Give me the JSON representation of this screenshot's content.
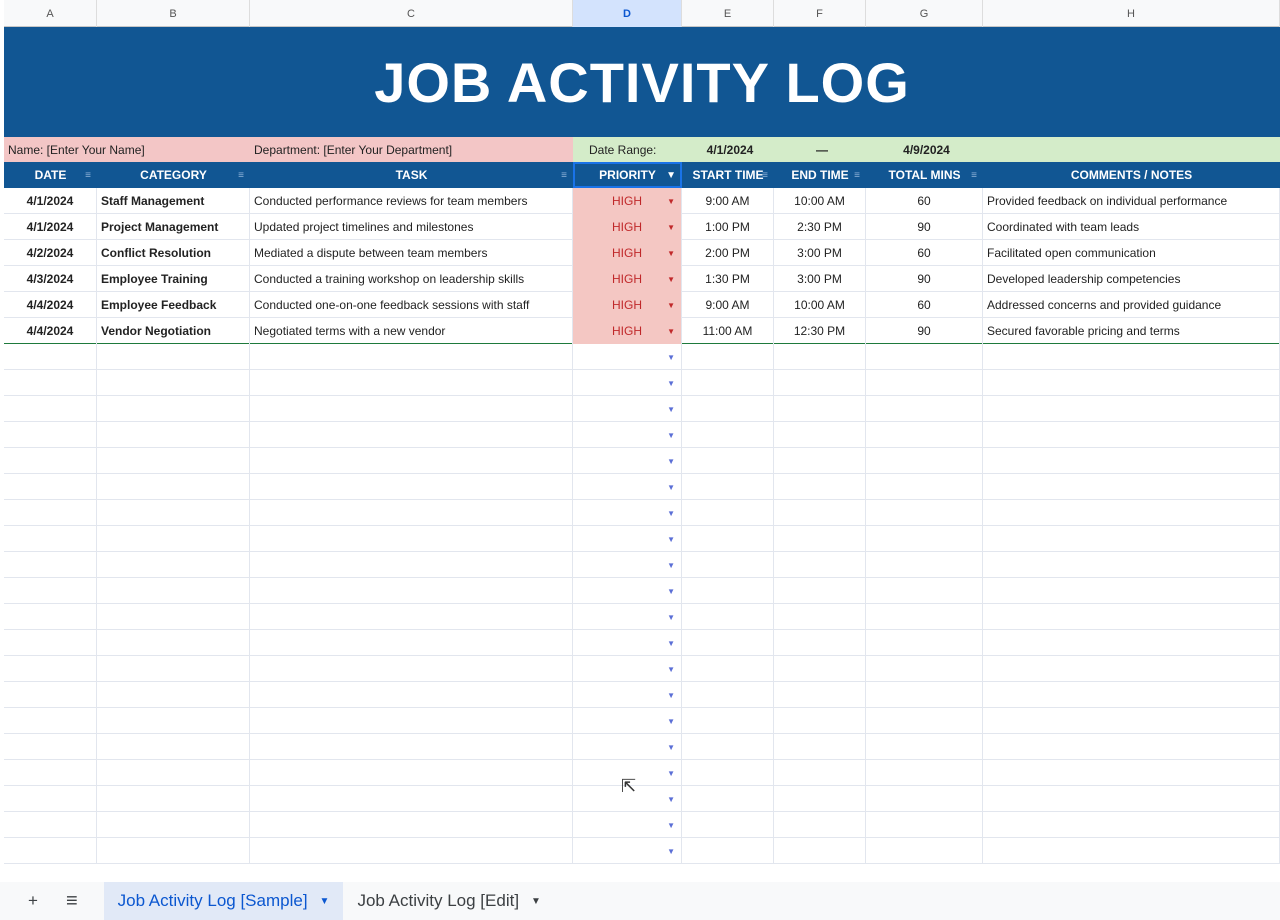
{
  "columns": [
    "A",
    "B",
    "C",
    "D",
    "E",
    "F",
    "G",
    "H"
  ],
  "title": "JOB ACTIVITY LOG",
  "info": {
    "name": "Name: [Enter Your Name]",
    "department": "Department: [Enter Your Department]",
    "date_range_label": "Date Range:",
    "start": "4/1/2024",
    "dash": "—",
    "end": "4/9/2024"
  },
  "headers": [
    "DATE",
    "CATEGORY",
    "TASK",
    "PRIORITY",
    "START TIME",
    "END TIME",
    "TOTAL MINS",
    "COMMENTS / NOTES"
  ],
  "rows": [
    [
      "4/1/2024",
      "Staff Management",
      "Conducted performance reviews for team members",
      "HIGH",
      "9:00 AM",
      "10:00 AM",
      "60",
      "Provided feedback on individual performance"
    ],
    [
      "4/1/2024",
      "Project Management",
      "Updated project timelines and milestones",
      "HIGH",
      "1:00 PM",
      "2:30 PM",
      "90",
      "Coordinated with team leads"
    ],
    [
      "4/2/2024",
      "Conflict Resolution",
      "Mediated a dispute between team members",
      "HIGH",
      "2:00 PM",
      "3:00 PM",
      "60",
      "Facilitated open communication"
    ],
    [
      "4/3/2024",
      "Employee Training",
      "Conducted a training workshop on leadership skills",
      "HIGH",
      "1:30 PM",
      "3:00 PM",
      "90",
      "Developed leadership competencies"
    ],
    [
      "4/4/2024",
      "Employee Feedback",
      "Conducted one-on-one feedback sessions with staff",
      "HIGH",
      "9:00 AM",
      "10:00 AM",
      "60",
      "Addressed concerns and provided guidance"
    ],
    [
      "4/4/2024",
      "Vendor Negotiation",
      "Negotiated terms with a new vendor",
      "HIGH",
      "11:00 AM",
      "12:30 PM",
      "90",
      "Secured favorable pricing and terms"
    ]
  ],
  "empty_rows": 20,
  "tabs": {
    "add": "+",
    "menu": "≡",
    "sheets": [
      "Job Activity Log [Sample]",
      "Job Activity Log [Edit]"
    ],
    "active": 0
  }
}
